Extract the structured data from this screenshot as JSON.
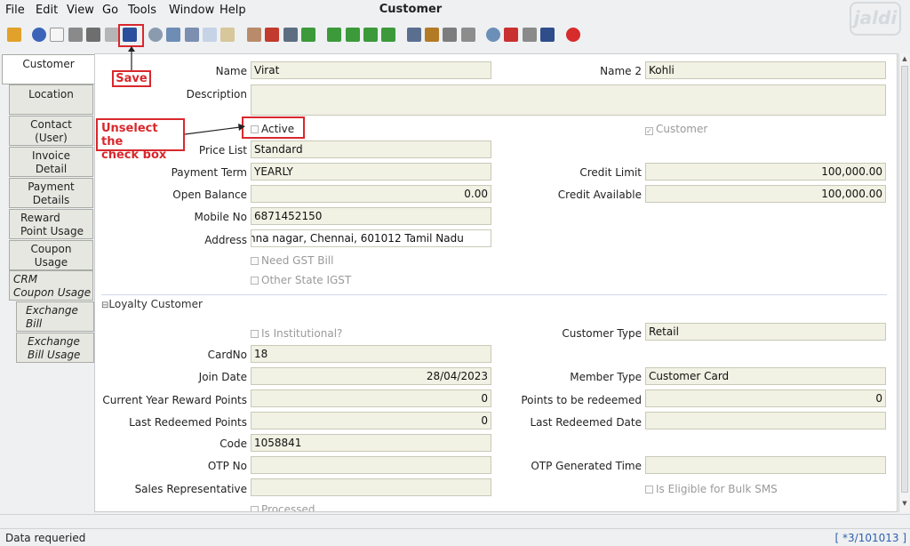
{
  "menu": [
    "File",
    "Edit",
    "View",
    "Go",
    "Tools",
    "Window",
    "Help"
  ],
  "window_title": "Customer",
  "brand": "jaldi",
  "tabs": [
    "Customer",
    "Location",
    "Contact\n(User)",
    "Invoice\nDetail",
    "Payment\nDetails",
    "Reward\nPoint Usage",
    "Coupon\nUsage",
    "CRM\nCoupon Usage",
    "Exchange\nBill",
    "Exchange\nBill Usage"
  ],
  "form": {
    "name_label": "Name",
    "name_value": "Virat",
    "name2_label": "Name 2",
    "name2_value": "Kohli",
    "description_label": "Description",
    "description_value": "",
    "active_label": "Active",
    "customer_label": "Customer",
    "price_list_label": "Price List",
    "price_list_value": "Standard",
    "payment_term_label": "Payment Term",
    "payment_term_value": "YEARLY",
    "credit_limit_label": "Credit Limit",
    "credit_limit_value": "100,000.00",
    "open_balance_label": "Open Balance",
    "open_balance_value": "0.00",
    "credit_available_label": "Credit Available",
    "credit_available_value": "100,000.00",
    "mobile_label": "Mobile No",
    "mobile_value": "6871452150",
    "address_label": "Address",
    "address_value": "nna nagar, Chennai,  601012 Tamil Nadu",
    "need_gst_label": "Need GST Bill",
    "other_state_label": "Other State IGST",
    "loyalty_section": "Loyalty Customer",
    "institutional_label": "Is Institutional?",
    "customer_type_label": "Customer Type",
    "customer_type_value": "Retail",
    "cardno_label": "CardNo",
    "cardno_value": "18",
    "join_date_label": "Join Date",
    "join_date_value": "28/04/2023",
    "member_type_label": "Member Type",
    "member_type_value": "Customer Card",
    "cy_reward_label": "Current Year Reward Points",
    "cy_reward_value": "0",
    "to_redeem_label": "Points to be redeemed",
    "to_redeem_value": "0",
    "last_redeemed_label": "Last Redeemed Points",
    "last_redeemed_value": "0",
    "last_redeemed_date_label": "Last Redeemed Date",
    "last_redeemed_date_value": "",
    "code_label": "Code",
    "code_value": "1058841",
    "otp_label": "OTP No",
    "otp_value": "",
    "otp_time_label": "OTP Generated Time",
    "otp_time_value": "",
    "sales_rep_label": "Sales Representative",
    "sales_rep_value": "",
    "bulk_sms_label": "Is Eligible for Bulk SMS",
    "processed_label": "Processed"
  },
  "annotations": {
    "save": "Save",
    "unselect": "Unselect the\ncheck box"
  },
  "status": {
    "left": "Data requeried",
    "right": "[ *3/101013 ]"
  },
  "colors": {
    "field_bg": "#f1f1e4",
    "annotation_red": "#d8282d",
    "status_blue": "#2f5fae"
  }
}
